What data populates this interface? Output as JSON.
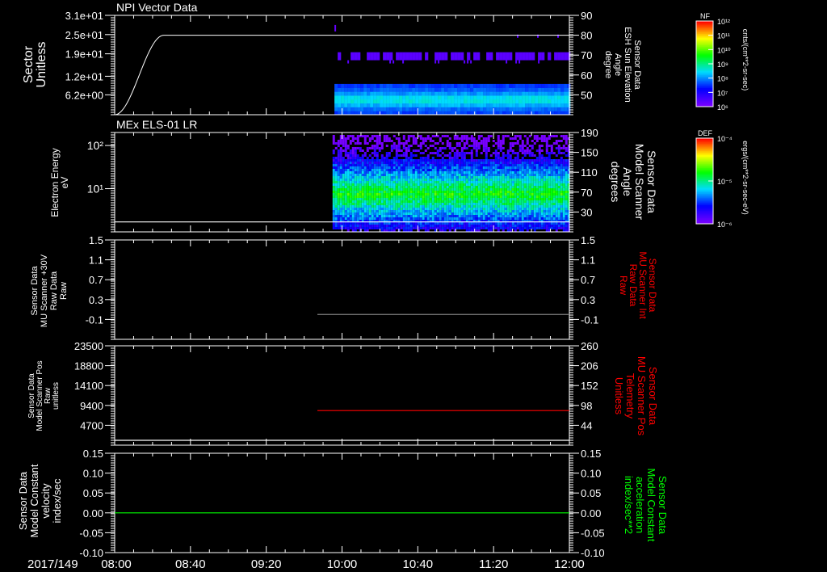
{
  "time_axis": {
    "date_label": "2017/149",
    "ticks": [
      "08:00",
      "08:40",
      "09:20",
      "10:00",
      "10:40",
      "11:20",
      "12:00"
    ],
    "range": [
      "08:00",
      "12:00"
    ]
  },
  "colors": {
    "axis": "#ffffff",
    "red": "#ff0000",
    "green": "#00ff00",
    "gray": "#808080"
  },
  "colorbars": [
    {
      "title": "NF",
      "unit": "cnts/(cm**2-sr-sec)",
      "ticks": [
        "10¹²",
        "10¹¹",
        "10¹⁰",
        "10⁹",
        "10⁸",
        "10⁷",
        "10⁶"
      ]
    },
    {
      "title": "DEF",
      "unit": "ergs/(cm**2-sr-sec-eV)",
      "ticks": [
        "10⁻⁴",
        "10⁻⁵",
        "10⁻⁶"
      ]
    }
  ],
  "chart_data": [
    {
      "type": "heatmap",
      "title": "NPI Vector Data",
      "ylabel": [
        "Sector",
        "Unitless"
      ],
      "yticks": [
        "3.1e+01",
        "2.5e+01",
        "1.9e+01",
        "1.2e+01",
        "6.2e+00"
      ],
      "ylim": [
        0,
        31
      ],
      "y2label": [
        "Sensor Data",
        "ESH Sun Elevation",
        "Angle",
        "degree"
      ],
      "y2ticks": [
        "90",
        "80",
        "70",
        "60",
        "50"
      ],
      "y2lim": [
        40,
        90
      ],
      "line": {
        "axis": "y",
        "x": [
          "08:00",
          "08:10",
          "08:20",
          "08:26",
          "12:00"
        ],
        "y": [
          0,
          9,
          21,
          24.8,
          24.8
        ]
      },
      "heatmap_start": "09:56",
      "heatmap_bands": [
        {
          "sector_range": [
            0,
            9.5
          ],
          "level": "cyan-blue"
        },
        {
          "sector_range": [
            16,
            20
          ],
          "level": "purple, sparse"
        }
      ]
    },
    {
      "type": "heatmap",
      "title": "MEx ELS-01 LR",
      "ylabel": [
        "Electron Energy",
        "eV"
      ],
      "yticks": [
        "10²",
        "10¹"
      ],
      "ylog": true,
      "ylim": [
        1,
        200
      ],
      "y2label": [
        "Sensor Data",
        "Model Scanner",
        "Angle",
        "degrees"
      ],
      "y2ticks": [
        "190",
        "150",
        "110",
        "70",
        "30"
      ],
      "y2lim": [
        -10,
        190
      ],
      "line": {
        "axis": "y2",
        "x": [
          "08:00",
          "12:00"
        ],
        "y": [
          10,
          10
        ]
      },
      "heatmap_start": "09:55",
      "energy_profile": {
        "peak_eV": 8,
        "peak_level": "green",
        "edges_level": "purple"
      }
    },
    {
      "type": "line",
      "ylabel": [
        "Sensor Data",
        "MU Scanner +30V",
        "Raw Data",
        "Raw"
      ],
      "yticks": [
        "1.5",
        "1.1",
        "0.7",
        "0.3",
        "-0.1"
      ],
      "ylim": [
        -0.5,
        1.5
      ],
      "y2label": [
        "Sensor Data",
        "MU Scanner Int",
        "Raw Data",
        "Raw"
      ],
      "y2ticks": [
        "1.5",
        "1.1",
        "0.7",
        "0.3",
        "-0.1"
      ],
      "y2lim": [
        -0.5,
        1.5
      ],
      "series": [
        {
          "axis": "y2",
          "color": "#808080",
          "x": [
            "09:47",
            "12:00"
          ],
          "y": [
            0,
            0
          ]
        }
      ]
    },
    {
      "type": "line",
      "ylabel": [
        "Sensor Data",
        "Model Scanner Pos",
        "Raw",
        "unitless"
      ],
      "yticks": [
        "23500",
        "18800",
        "14100",
        "9400",
        "4700"
      ],
      "ylim": [
        0,
        23500
      ],
      "y2label": [
        "Sensor Data",
        "MU Scanner Pos",
        "Telemetry",
        "Unitless"
      ],
      "y2ticks": [
        "260",
        "206",
        "152",
        "98",
        "44"
      ],
      "y2lim": [
        -10,
        260
      ],
      "series": [
        {
          "axis": "y",
          "color": "#ffffff",
          "x": [
            "08:00",
            "12:00"
          ],
          "y": [
            1150,
            1150
          ]
        },
        {
          "axis": "y2",
          "color": "#ff0000",
          "x": [
            "09:47",
            "12:00"
          ],
          "y": [
            84,
            84
          ]
        }
      ]
    },
    {
      "type": "line",
      "ylabel": [
        "Sensor Data",
        "Model Constant",
        "velocity",
        "index/sec"
      ],
      "yticks": [
        "0.15",
        "0.10",
        "0.05",
        "0.00",
        "-0.05",
        "-0.10"
      ],
      "ylim": [
        -0.1,
        0.15
      ],
      "y2label": [
        "Sensor Data",
        "Model Constant",
        "acceleration",
        "index/sec**2"
      ],
      "y2ticks": [
        "0.15",
        "0.10",
        "0.05",
        "0.00",
        "-0.05",
        "-0.10"
      ],
      "y2lim": [
        -0.1,
        0.15
      ],
      "series": [
        {
          "axis": "y",
          "color": "#00ff00",
          "x": [
            "08:00",
            "12:00"
          ],
          "y": [
            0,
            0
          ]
        }
      ]
    }
  ]
}
